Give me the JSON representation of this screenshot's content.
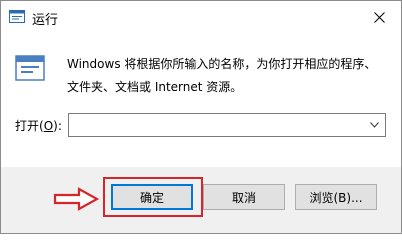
{
  "window": {
    "title": "运行",
    "description_line1": "Windows 将根据你所输入的名称，为你打开相应的程序、",
    "description_line2": "文件夹、文档或 Internet 资源。"
  },
  "open_field": {
    "label_prefix": "打开(",
    "label_hotkey": "O",
    "label_suffix": "):",
    "value": ""
  },
  "buttons": {
    "ok": "确定",
    "cancel": "取消",
    "browse": "浏览(B)..."
  },
  "annotation": {
    "highlight_color": "#d6262a"
  },
  "icons": {
    "title": "run-app-icon",
    "close": "close-icon",
    "run": "run-dialog-icon",
    "dropdown": "chevron-down-icon",
    "pointer": "red-arrow-icon"
  }
}
